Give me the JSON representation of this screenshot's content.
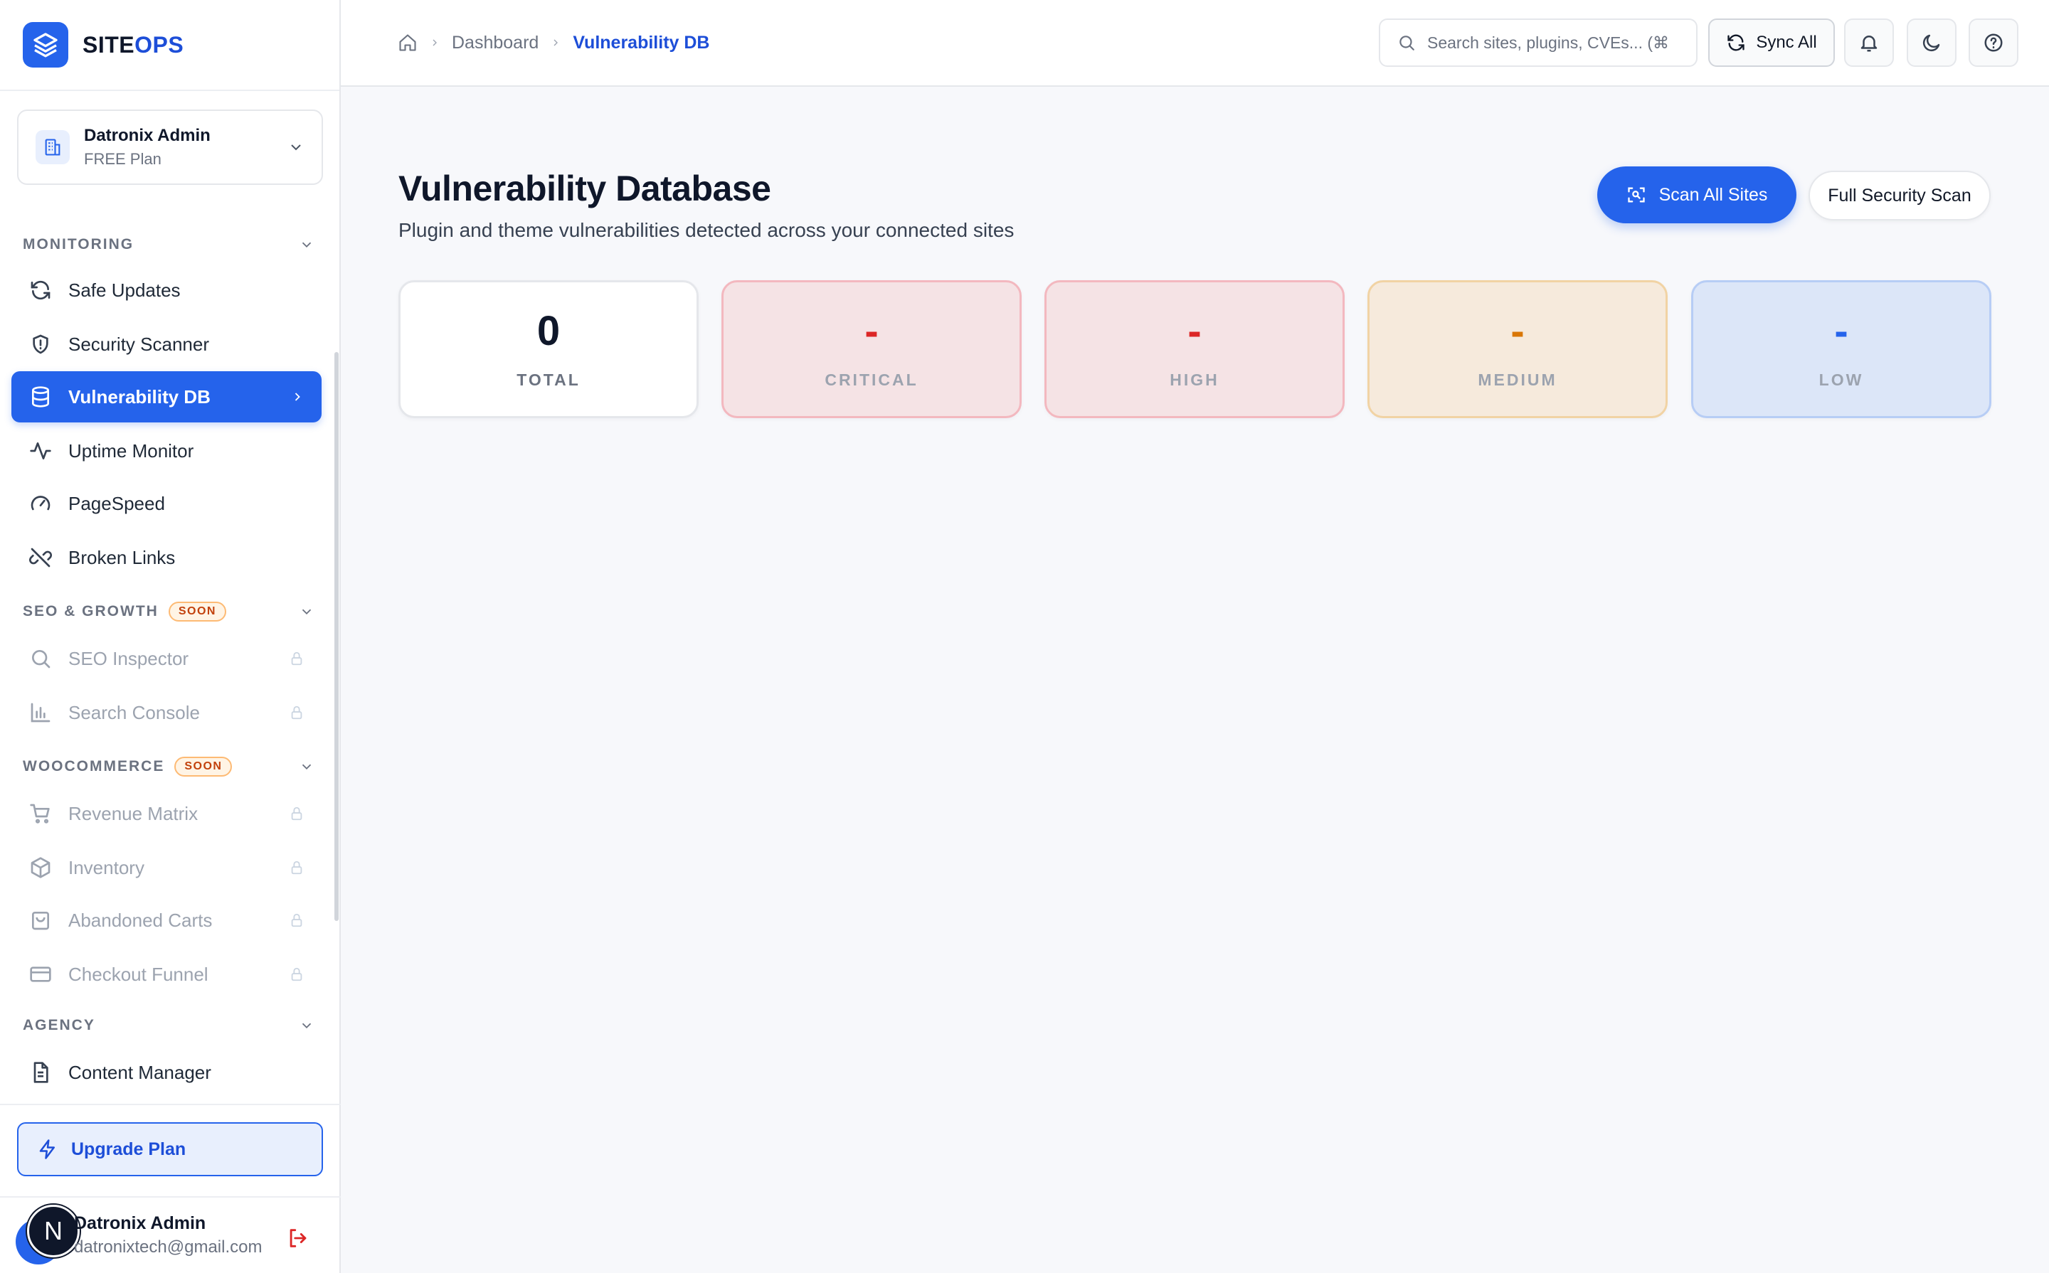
{
  "brand": {
    "name_main": "SITE",
    "name_accent": "OPS"
  },
  "workspace": {
    "name": "Datronix Admin",
    "plan": "FREE Plan"
  },
  "sidebar": {
    "sections": [
      {
        "title": "MONITORING",
        "badge": ""
      },
      {
        "title": "SEO & GROWTH",
        "badge": "SOON"
      },
      {
        "title": "WOOCOMMERCE",
        "badge": "SOON"
      },
      {
        "title": "AGENCY",
        "badge": ""
      }
    ],
    "items": [
      {
        "label": "Safe Updates",
        "icon": "refresh-icon"
      },
      {
        "label": "Security Scanner",
        "icon": "shield-icon"
      },
      {
        "label": "Vulnerability DB",
        "icon": "database-icon"
      },
      {
        "label": "Uptime Monitor",
        "icon": "activity-icon"
      },
      {
        "label": "PageSpeed",
        "icon": "gauge-icon"
      },
      {
        "label": "Broken Links",
        "icon": "unlink-icon"
      },
      {
        "label": "SEO Inspector",
        "icon": "search-icon"
      },
      {
        "label": "Search Console",
        "icon": "bar-chart-icon"
      },
      {
        "label": "Revenue Matrix",
        "icon": "cart-icon"
      },
      {
        "label": "Inventory",
        "icon": "box-icon"
      },
      {
        "label": "Abandoned Carts",
        "icon": "bag-icon"
      },
      {
        "label": "Checkout Funnel",
        "icon": "credit-card-icon"
      },
      {
        "label": "Content Manager",
        "icon": "document-icon"
      }
    ],
    "upgrade_label": "Upgrade Plan"
  },
  "user": {
    "initial": "N",
    "name": "Datronix Admin",
    "email": "datronixtech@gmail.com"
  },
  "topbar": {
    "breadcrumbs": [
      "Dashboard",
      "Vulnerability DB"
    ],
    "search_placeholder": "Search sites, plugins, CVEs... (⌘K)",
    "sync_label": "Sync All"
  },
  "main": {
    "title": "Vulnerability Database",
    "subtitle": "Plugin and theme vulnerabilities detected across your connected sites",
    "scan_all_label": "Scan All Sites",
    "full_scan_label": "Full Security Scan",
    "stats": [
      {
        "label": "TOTAL",
        "value": "0"
      },
      {
        "label": "CRITICAL",
        "value": "-"
      },
      {
        "label": "HIGH",
        "value": "-"
      },
      {
        "label": "MEDIUM",
        "value": "-"
      },
      {
        "label": "LOW",
        "value": "-"
      }
    ]
  },
  "colors": {
    "accent": "#2563eb",
    "critical": "#dc2626",
    "medium": "#d97706",
    "low": "#2563eb",
    "soon_badge": "#c2410c"
  }
}
